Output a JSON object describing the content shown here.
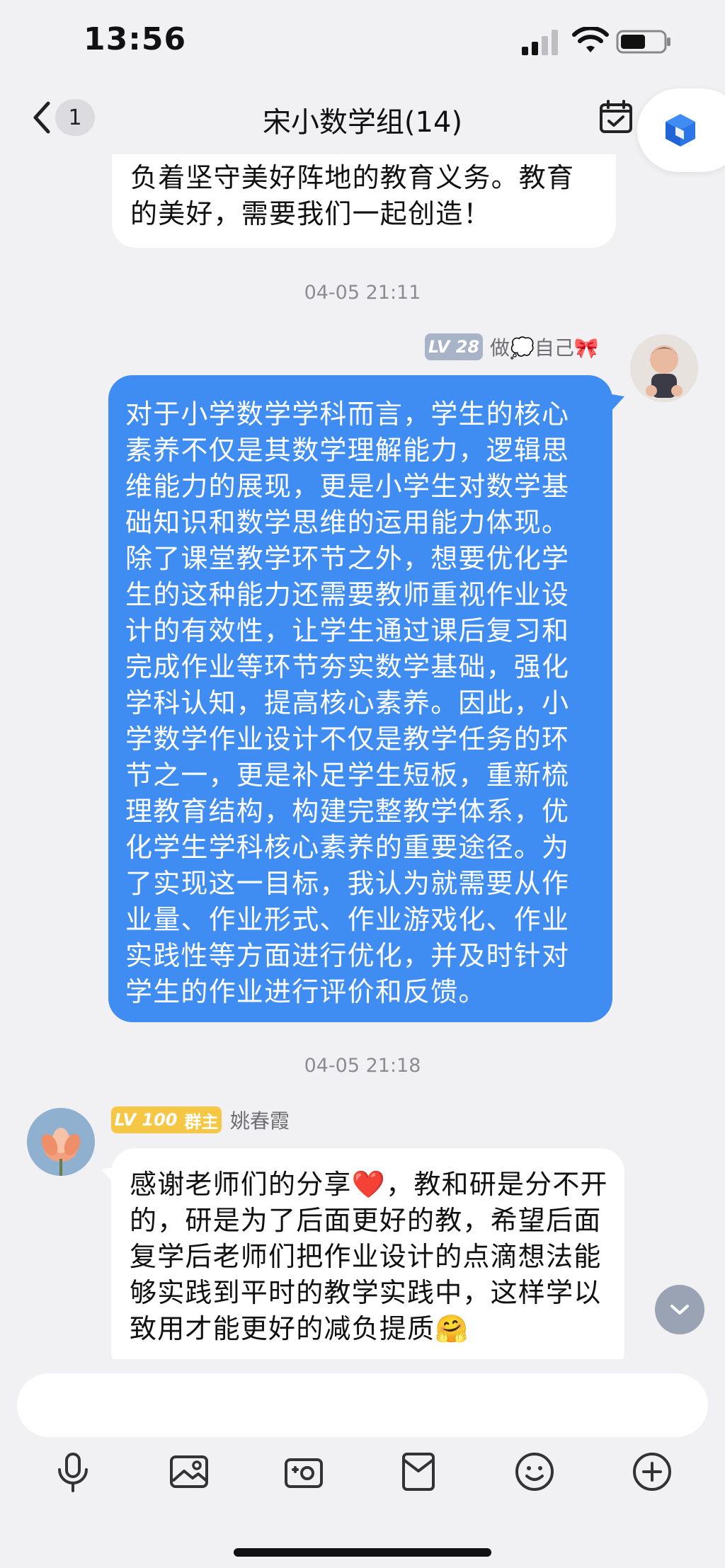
{
  "status": {
    "time": "13:56"
  },
  "nav": {
    "unread": "1",
    "title": "宋小数学组(14)"
  },
  "messages": {
    "prev_text": "负着坚守美好阵地的教育义务。教育的美好，需要我们一起创造！",
    "ts1": "04-05 21:11",
    "self": {
      "level": "LV 28",
      "nick": "做💭自己🎀",
      "text": "对于小学数学学科而言，学生的核心素养不仅是其数学理解能力，逻辑思维能力的展现，更是小学生对数学基础知识和数学思维的运用能力体现。除了课堂教学环节之外，想要优化学生的这种能力还需要教师重视作业设计的有效性，让学生通过课后复习和完成作业等环节夯实数学基础，强化学科认知，提高核心素养。因此，小学数学作业设计不仅是教学任务的环节之一，更是补足学生短板，重新梳理教育结构，构建完整教学体系，优化学生学科核心素养的重要途径。为了实现这一目标，我认为就需要从作业量、作业形式、作业游戏化、作业实践性等方面进行优化，并及时针对学生的作业进行评价和反馈。"
    },
    "ts2": "04-05 21:18",
    "other": {
      "level": "LV 100",
      "role": "群主",
      "nick": "姚春霞",
      "text": "感谢老师们的分享❤️，教和研是分不开的，研是为了后面更好的教，希望后面复学后老师们把作业设计的点滴想法能够实践到平时的教学实践中，这样学以致用才能更好的减负提质🤗"
    }
  },
  "colors": {
    "accent": "#3f8cf2",
    "owner_tag": "#f6c744",
    "level_tag": "#a9b3c7"
  },
  "icons": {
    "toolbar": [
      "microphone-icon",
      "image-icon",
      "camera-icon",
      "red-packet-icon",
      "emoji-icon",
      "plus-icon"
    ]
  }
}
